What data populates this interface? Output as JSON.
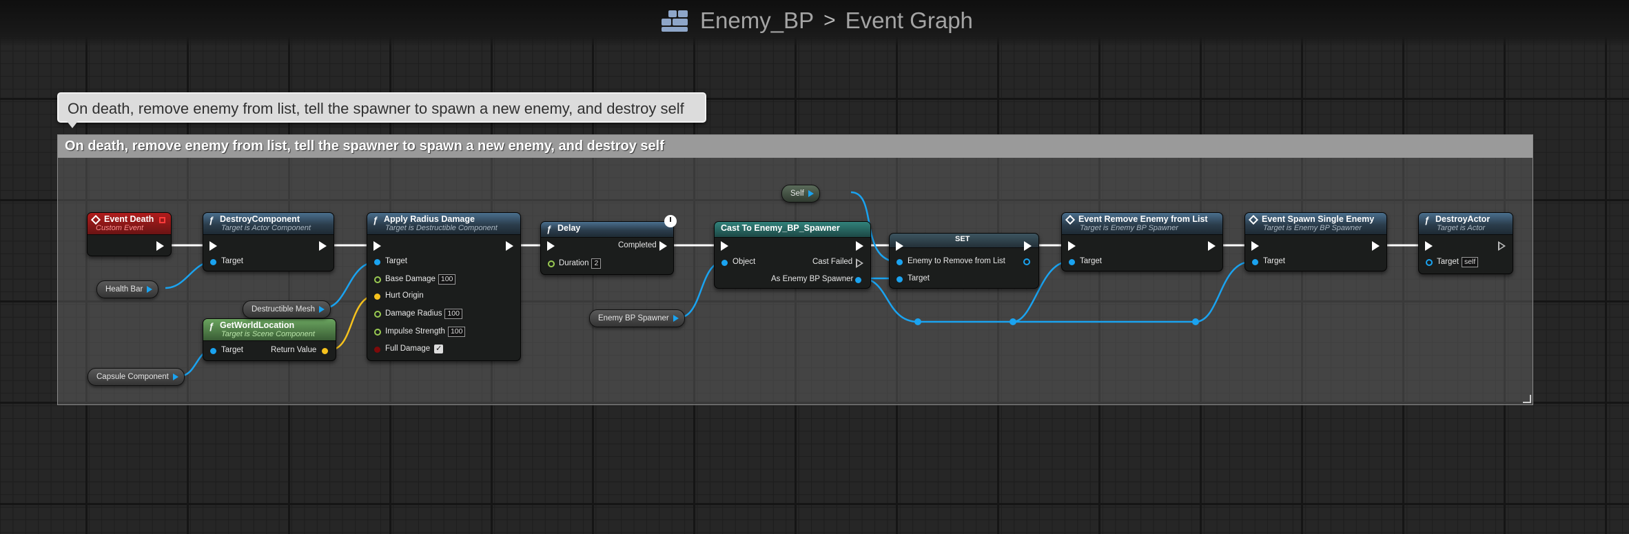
{
  "header": {
    "asset_name": "Enemy_BP",
    "separator": ">",
    "graph_name": "Event Graph"
  },
  "tooltip": "On death, remove enemy from list, tell the spawner to spawn a new enemy, and destroy self",
  "comment": {
    "title": "On death, remove enemy from list, tell the spawner to spawn a new enemy, and destroy self"
  },
  "nodes": {
    "event_death": {
      "title": "Event Death",
      "subtitle": "Custom Event"
    },
    "destroy_component": {
      "title": "DestroyComponent",
      "subtitle": "Target is Actor Component",
      "target": "Target"
    },
    "apply_radius_damage": {
      "title": "Apply Radius Damage",
      "subtitle": "Target is Destructible Component",
      "target": "Target",
      "base_damage": "Base Damage",
      "base_damage_value": "100",
      "hurt_origin": "Hurt Origin",
      "damage_radius": "Damage Radius",
      "damage_radius_value": "100",
      "impulse_strength": "Impulse Strength",
      "impulse_strength_value": "100",
      "full_damage": "Full Damage",
      "full_damage_check": "✓"
    },
    "get_world_location": {
      "title": "GetWorldLocation",
      "subtitle": "Target is Scene Component",
      "target": "Target",
      "return_value": "Return Value"
    },
    "delay": {
      "title": "Delay",
      "completed": "Completed",
      "duration": "Duration",
      "duration_value": "2"
    },
    "cast": {
      "title": "Cast To Enemy_BP_Spawner",
      "object": "Object",
      "cast_failed": "Cast Failed",
      "as_spawner": "As Enemy BP Spawner"
    },
    "set": {
      "title": "SET",
      "enemy_to_remove": "Enemy to Remove from List",
      "target": "Target"
    },
    "remove_enemy": {
      "title": "Event Remove Enemy from List",
      "subtitle": "Target is Enemy BP Spawner",
      "target": "Target"
    },
    "spawn_single": {
      "title": "Event Spawn Single Enemy",
      "subtitle": "Target is Enemy BP Spawner",
      "target": "Target"
    },
    "destroy_actor": {
      "title": "DestroyActor",
      "subtitle": "Target is Actor",
      "target": "Target",
      "self_value": "self"
    }
  },
  "variables": {
    "self": "Self",
    "health_bar": "Health Bar",
    "destructible_mesh": "Destructible Mesh",
    "capsule_component": "Capsule Component",
    "enemy_bp_spawner": "Enemy BP Spawner"
  },
  "colors": {
    "object_pin": "#1aa3f0",
    "float_pin": "#9acb52",
    "vector_pin": "#f6c21d",
    "exec_wire": "#ffffff",
    "function_header": "#4a6f8e",
    "event_header": "#b01c1c",
    "pure_header": "#6aa45f",
    "cast_header": "#31827b"
  }
}
